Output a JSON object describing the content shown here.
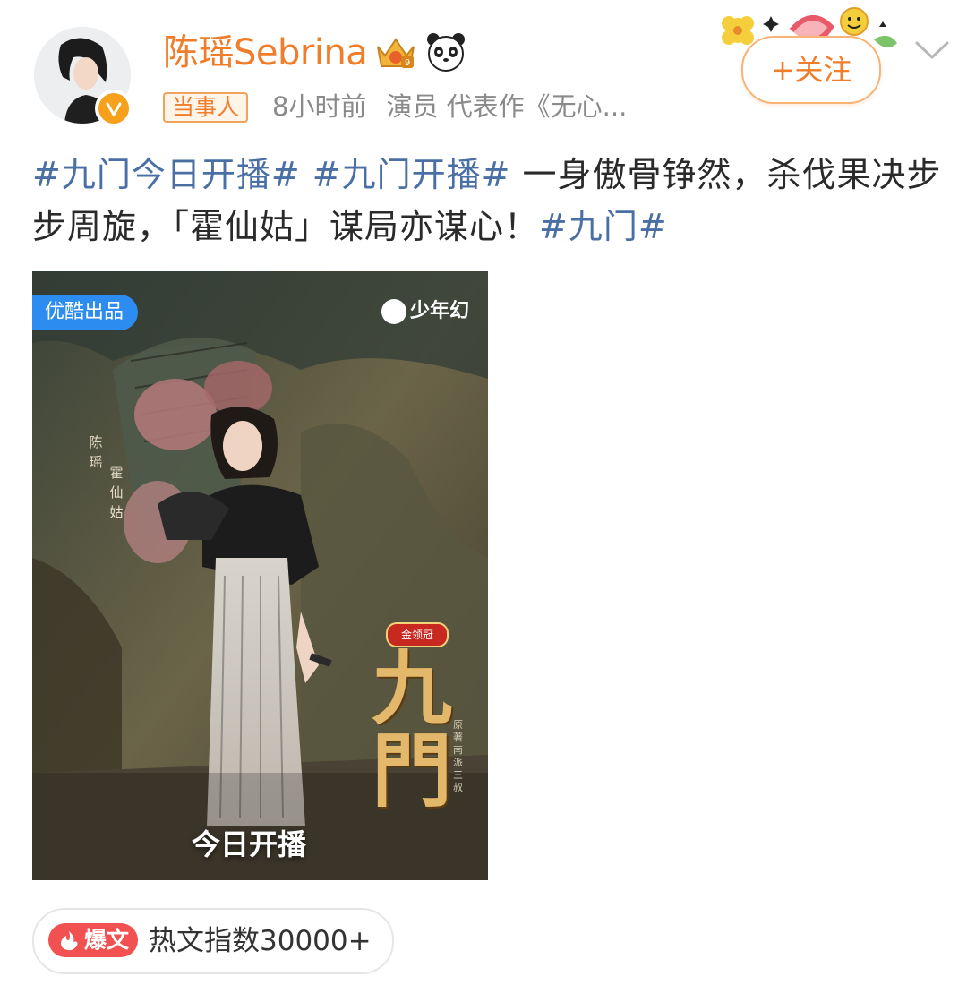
{
  "header": {
    "username": "陈瑶Sebrina",
    "role_badge": "当事人",
    "time": "8小时前",
    "occupation": "演员 代表作《无心...",
    "follow_label": "+关注",
    "icons": [
      "crown-icon",
      "panda-icon",
      "verified-icon",
      "chevron-down-icon"
    ]
  },
  "post": {
    "tag1": "#九门今日开播#",
    "tag2": "#九门开播#",
    "text": " 一身傲骨铮然，杀伐果决步步周旋，「霍仙姑」谋局亦谋心！",
    "tag3": "#九门#"
  },
  "poster": {
    "badge": "优酷出品",
    "brand": "少年幻",
    "side_label_1": "陈瑶",
    "side_label_2": "霍仙姑",
    "award": "金领冠",
    "title": "九門",
    "credits": "原著南派三叔",
    "premiere": "今日开播"
  },
  "hot": {
    "badge": "爆文",
    "label": "热文指数30000+"
  },
  "colors": {
    "accent": "#f07d2a",
    "hashtag": "#4a6fa5",
    "hot_red": "#f25151",
    "youku_blue": "#2d8cf0"
  }
}
